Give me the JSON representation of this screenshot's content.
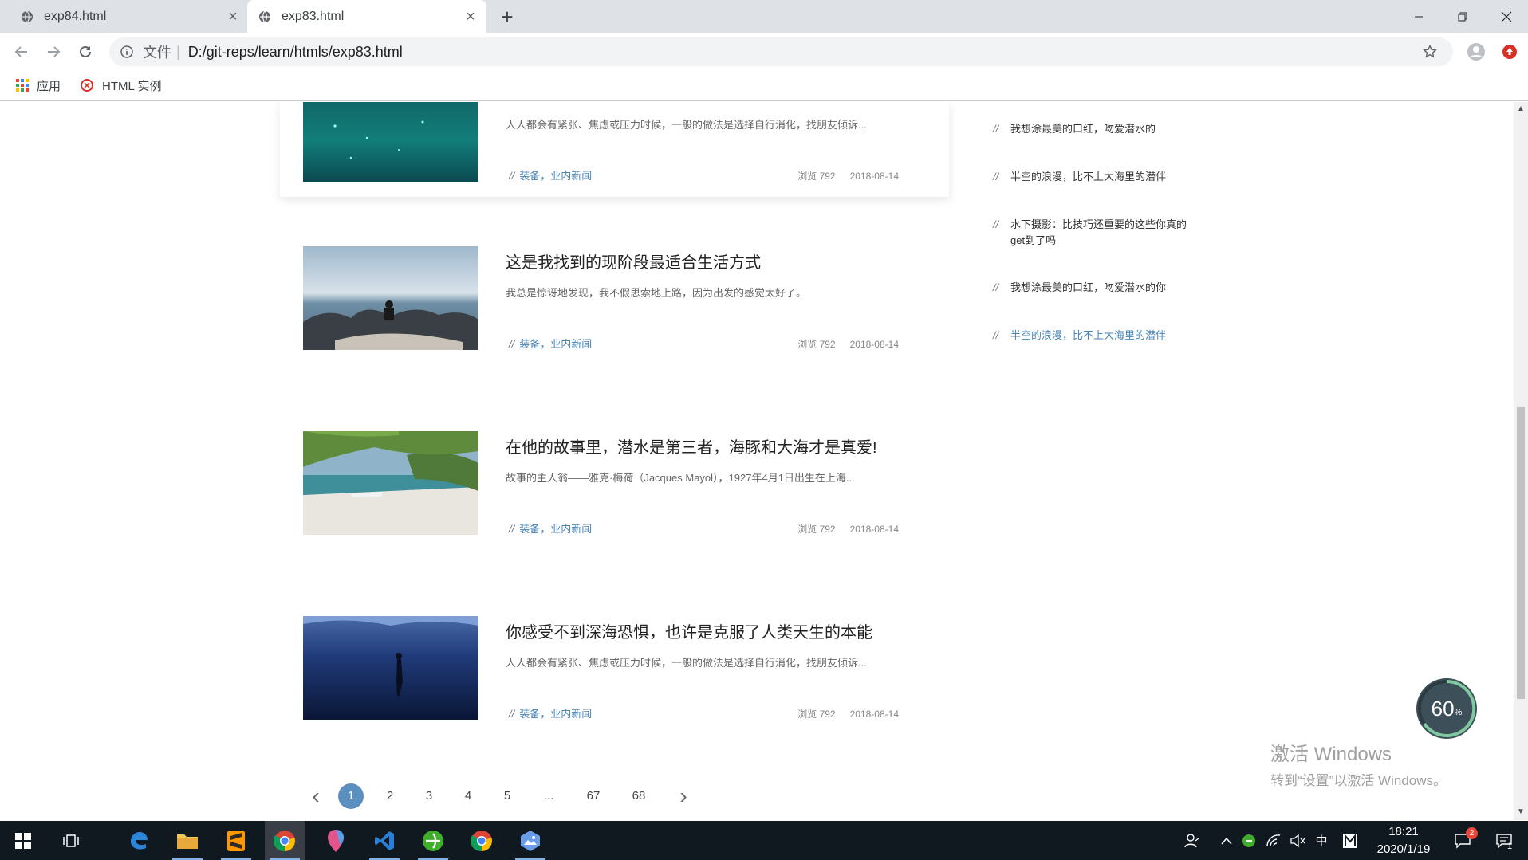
{
  "browser": {
    "tabs": [
      {
        "label": "exp84.html",
        "active": false
      },
      {
        "label": "exp83.html",
        "active": true
      }
    ],
    "address": {
      "prefix": "文件",
      "separator": "|",
      "url": "D:/git-reps/learn/htmls/exp83.html"
    },
    "bookmarks": [
      {
        "label": "应用",
        "icon": "apps-grid-icon"
      },
      {
        "label": "HTML 实例",
        "icon": "runoob-logo-icon"
      }
    ]
  },
  "articles": [
    {
      "title": "",
      "desc": "人人都会有紧张、焦虑或压力时候，一般的做法是选择自行消化，找朋友倾诉...",
      "tags": "装备，业内新闻",
      "views": "浏览 792",
      "date": "2018-08-14",
      "image": "underwater-teal"
    },
    {
      "title": "这是我找到的现阶段最适合生活方式",
      "desc": "我总是惊讶地发现，我不假思索地上路，因为出发的感觉太好了。",
      "tags": "装备，业内新闻",
      "views": "浏览 792",
      "date": "2018-08-14",
      "image": "rocks-sea"
    },
    {
      "title": "在他的故事里，潜水是第三者，海豚和大海才是真爱!",
      "desc": "故事的主人翁——雅克·梅荷（Jacques Mayol），1927年4月1日出生在上海...",
      "tags": "装备，业内新闻",
      "views": "浏览 792",
      "date": "2018-08-14",
      "image": "tropical-beach"
    },
    {
      "title": "你感受不到深海恐惧，也许是克服了人类天生的本能",
      "desc": "人人都会有紧张、焦虑或压力时候，一般的做法是选择自行消化，找朋友倾诉...",
      "tags": "装备，业内新闻",
      "views": "浏览 792",
      "date": "2018-08-14",
      "image": "deep-diver"
    }
  ],
  "sidebar": {
    "items": [
      {
        "text": "我想涂最美的口红，吻爱潜水的",
        "link": false
      },
      {
        "text": "半空的浪漫，比不上大海里的潜伴",
        "link": false
      },
      {
        "text": "水下摄影：比技巧还重要的这些你真的get到了吗",
        "link": false
      },
      {
        "text": "我想涂最美的口红，吻爱潜水的你",
        "link": false
      },
      {
        "text": "半空的浪漫，比不上大海里的潜伴",
        "link": true
      }
    ]
  },
  "pagination": {
    "prev": "‹",
    "pages": [
      "1",
      "2",
      "3",
      "4",
      "5",
      "...",
      "67",
      "68"
    ],
    "current": "1",
    "next": "›"
  },
  "widgets": {
    "gauge": "60",
    "gauge_unit": "%",
    "watermark_line1": "激活 Windows",
    "watermark_line2": "转到“设置”以激活 Windows。"
  },
  "taskbar": {
    "time": "18:21",
    "date": "2020/1/19",
    "ime": "中",
    "notification_count": "2",
    "desktop_count": "1"
  },
  "colors": {
    "accent": "#5a8fbf",
    "tag_link": "#4a86b8",
    "taskbar": "#101820"
  }
}
